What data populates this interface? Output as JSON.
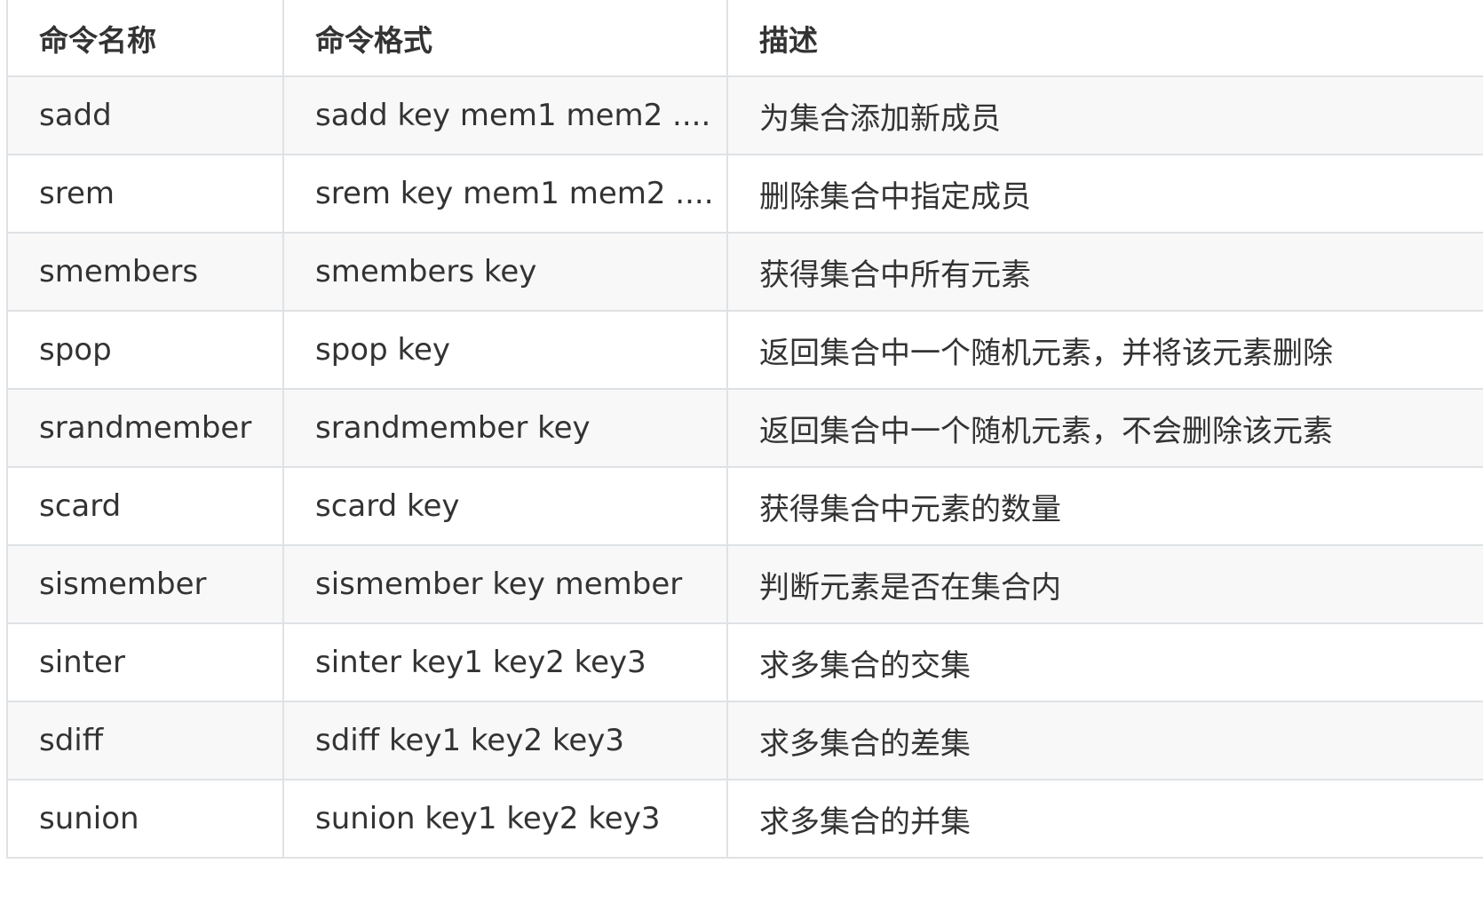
{
  "table": {
    "headers": [
      "命令名称",
      "命令格式",
      "描述"
    ],
    "rows": [
      [
        "sadd",
        "sadd key mem1 mem2 ....",
        "为集合添加新成员"
      ],
      [
        "srem",
        "srem key mem1 mem2 ....",
        "删除集合中指定成员"
      ],
      [
        "smembers",
        "smembers key",
        "获得集合中所有元素"
      ],
      [
        "spop",
        "spop key",
        "返回集合中一个随机元素，并将该元素删除"
      ],
      [
        "srandmember",
        "srandmember key",
        "返回集合中一个随机元素，不会删除该元素"
      ],
      [
        "scard",
        "scard key",
        "获得集合中元素的数量"
      ],
      [
        "sismember",
        "sismember key member",
        "判断元素是否在集合内"
      ],
      [
        "sinter",
        "sinter key1 key2 key3",
        "求多集合的交集"
      ],
      [
        "sdiff",
        "sdiff key1 key2 key3",
        "求多集合的差集"
      ],
      [
        "sunion",
        "sunion key1 key2 key3",
        "求多集合的并集"
      ]
    ]
  }
}
